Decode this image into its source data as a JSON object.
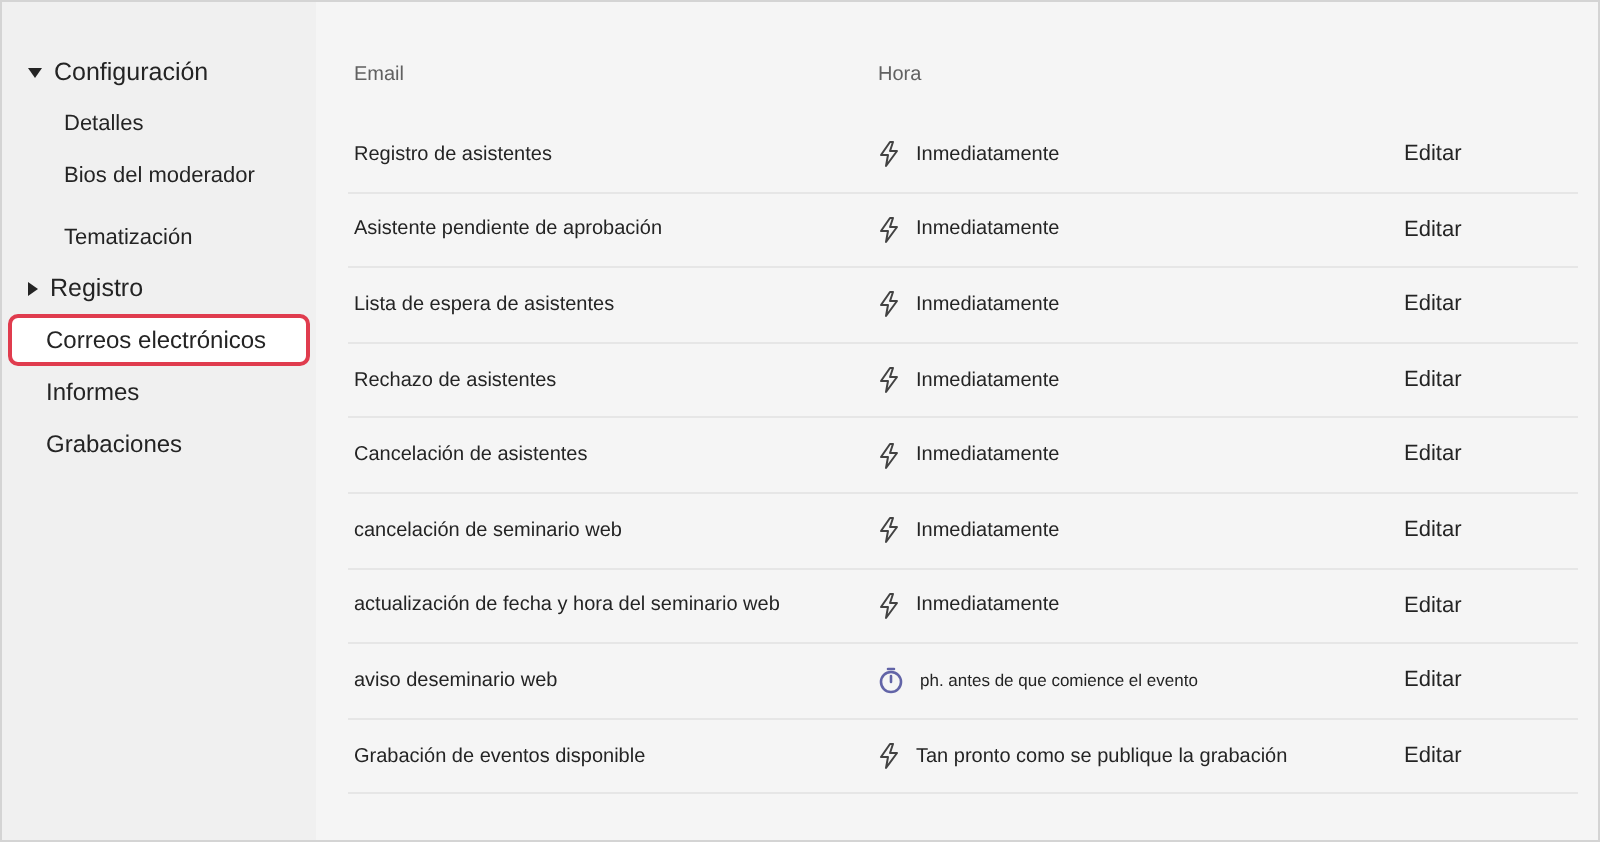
{
  "sidebar": {
    "items": [
      {
        "label": "Configuración",
        "expanded": true,
        "selected": false,
        "children": [
          {
            "label": "Detalles",
            "selected": false
          },
          {
            "label": "Bios del moderador",
            "selected": false
          },
          {
            "label": "Tematización",
            "selected": false
          }
        ]
      },
      {
        "label": "Registro",
        "expanded": false,
        "selected": false
      },
      {
        "label": "Correos electrónicos",
        "selected": true
      },
      {
        "label": "Informes",
        "selected": false
      },
      {
        "label": "Grabaciones",
        "selected": false
      }
    ]
  },
  "table": {
    "columns": [
      "Email",
      "Hora"
    ],
    "rows": [
      {
        "email": "Registro de asistentes",
        "kind": "instant",
        "time": "Inmediatamente",
        "action": "Editar"
      },
      {
        "email": "Asistente pendiente de aprobación",
        "kind": "instant",
        "time": "Inmediatamente",
        "action": "Editar"
      },
      {
        "email": "Lista de espera de asistentes",
        "kind": "instant",
        "time": "Inmediatamente",
        "action": "Editar"
      },
      {
        "email": "Rechazo de asistentes",
        "kind": "instant",
        "time": "Inmediatamente",
        "action": "Editar"
      },
      {
        "email": "Cancelación de asistentes",
        "kind": "instant",
        "time": "Inmediatamente",
        "action": "Editar"
      },
      {
        "email": "cancelación de seminario web",
        "kind": "instant",
        "time": "Inmediatamente",
        "action": "Editar"
      },
      {
        "email": "actualización de fecha y hora del seminario web",
        "kind": "instant",
        "time": "Inmediatamente",
        "action": "Editar"
      },
      {
        "email": "aviso deseminario web",
        "kind": "timer",
        "time": "ph. antes de que comience el evento",
        "action": "Editar"
      },
      {
        "email": "Grabación de eventos disponible",
        "kind": "instant",
        "time": "Tan pronto como se publique la grabación",
        "action": "Editar"
      }
    ]
  }
}
